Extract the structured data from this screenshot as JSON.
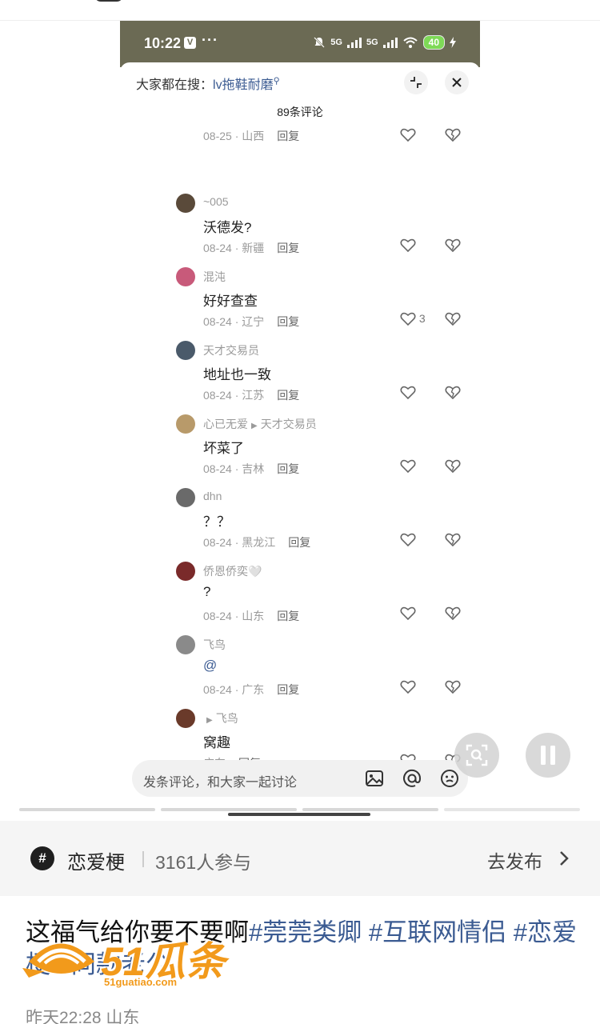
{
  "phone_status": {
    "time": "10:22",
    "app_badge": "V",
    "more_dots": "···",
    "network_1": "5G",
    "network_2": "5G",
    "battery": "40"
  },
  "comment_sheet": {
    "search_prefix": "大家都在搜：",
    "search_term": "lv拖鞋耐磨",
    "search_icon": "search-icon",
    "count_title": "89条评论",
    "reply_label": "回复",
    "comments": [
      {
        "user": "",
        "text": "",
        "date": "08-25",
        "region": "山西",
        "likes": ""
      },
      {
        "user": "~005",
        "text": "沃德发?",
        "date": "08-24",
        "region": "新疆",
        "likes": ""
      },
      {
        "user": "混沌",
        "text": "好好查查",
        "date": "08-24",
        "region": "辽宁",
        "likes": "3"
      },
      {
        "user": "天才交易员",
        "text": "地址也一致",
        "date": "08-24",
        "region": "江苏",
        "likes": ""
      },
      {
        "user": "心已无爱",
        "reply_to": "天才交易员",
        "text": "坏菜了",
        "date": "08-24",
        "region": "吉林",
        "likes": ""
      },
      {
        "user": "dhn",
        "text": "？？",
        "date": "08-24",
        "region": "黑龙江",
        "likes": ""
      },
      {
        "user": "侨恩侨奕🤍",
        "text": "?",
        "date": "08-24",
        "region": "山东",
        "likes": ""
      },
      {
        "user": "飞鸟",
        "text": "@",
        "date": "08-24",
        "region": "广东",
        "likes": ""
      },
      {
        "user": "",
        "reply_to": "飞鸟",
        "text": "窝趣",
        "date": "",
        "region": "广东",
        "likes": ""
      }
    ],
    "partial_next_user": "include",
    "input_placeholder": "发条评论，和大家一起讨论"
  },
  "topic": {
    "name": "恋爱梗",
    "participants": "3161人参与",
    "publish_label": "去发布"
  },
  "caption": {
    "text": "这福气给你要不要啊",
    "tags": [
      "#莞莞类卿",
      "#互联网情侣",
      "#恋爱梗",
      "#同款老公"
    ]
  },
  "datetime": "昨天22:28 山东",
  "watermark": {
    "text": "51瓜条",
    "subtext": "51guatiao.com"
  },
  "colors": {
    "accent_link": "#3b5b92",
    "status_bar": "#6b6a54",
    "battery": "#7ed957",
    "watermark": "#f29a1b"
  }
}
